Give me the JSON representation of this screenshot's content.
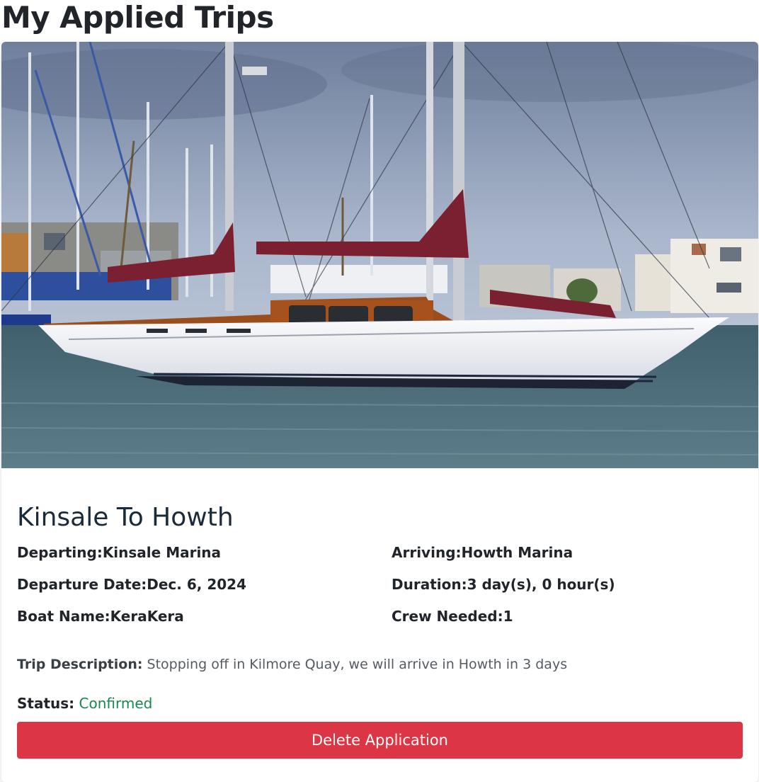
{
  "page": {
    "title": "My Applied Trips"
  },
  "trip": {
    "title": "Kinsale To Howth",
    "departing_label": "Departing:",
    "departing": "Kinsale Marina",
    "arriving_label": "Arriving:",
    "arriving": "Howth Marina",
    "departure_date_label": "Departure Date:",
    "departure_date": "Dec. 6, 2024",
    "duration_label": "Duration:",
    "duration": "3 day(s), 0 hour(s)",
    "boat_name_label": "Boat Name:",
    "boat_name": "KeraKera",
    "crew_needed_label": "Crew Needed:",
    "crew_needed": "1",
    "description_label": "Trip Description:",
    "description": "Stopping off in Kilmore Quay, we will arrive in Howth in 3 days",
    "status_label": "Status:",
    "status": "Confirmed",
    "delete_label": "Delete Application"
  },
  "colors": {
    "danger": "#dc3545",
    "success": "#198754",
    "sail_cover": "#7a2030"
  }
}
